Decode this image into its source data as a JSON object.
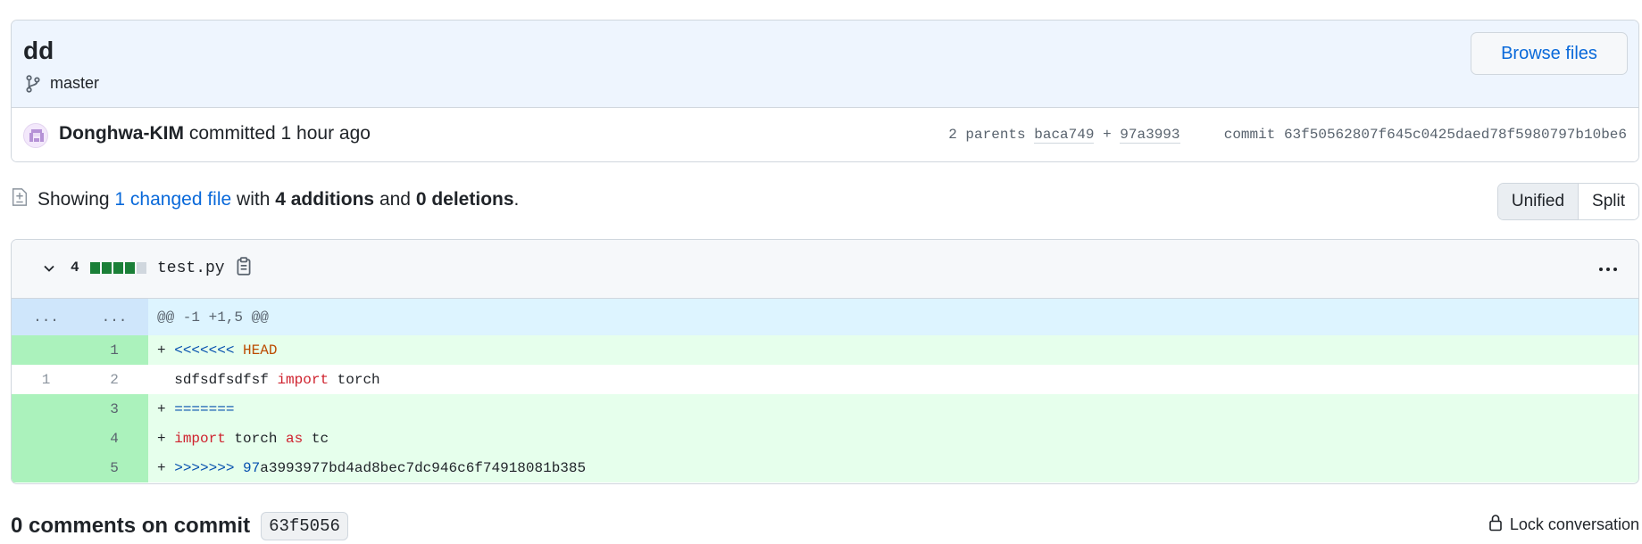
{
  "commit": {
    "title": "dd",
    "branch": "master",
    "browse_label": "Browse files",
    "author": "Donghwa-KIM",
    "action": "committed",
    "time": "1 hour ago",
    "parents_label": "2 parents",
    "parent1": "baca749",
    "parent_plus": "+",
    "parent2": "97a3993",
    "commit_label": "commit",
    "sha": "63f50562807f645c0425daed78f5980797b10be6"
  },
  "summary": {
    "showing": "Showing",
    "changed_files": "1 changed file",
    "with": "with",
    "additions": "4 additions",
    "and": "and",
    "deletions": "0 deletions",
    "period": "."
  },
  "view_toggle": {
    "unified": "Unified",
    "split": "Split",
    "active": "unified"
  },
  "file": {
    "changes": "4",
    "diffstat": {
      "added_blocks": 4,
      "empty_blocks": 1
    },
    "name": "test.py",
    "hunk": {
      "left": "...",
      "right": "...",
      "header": "@@ -1 +1,5 @@"
    },
    "lines": [
      {
        "type": "add",
        "left": "",
        "right": "1",
        "prefix": "+",
        "tokens": [
          [
            "<<<<<<<",
            "mk"
          ],
          [
            " ",
            ""
          ],
          [
            "HEAD",
            "or"
          ]
        ]
      },
      {
        "type": "ctx",
        "left": "1",
        "right": "2",
        "prefix": " ",
        "tokens": [
          [
            "sdfsdfsdfsf ",
            ""
          ],
          [
            "import",
            "kw"
          ],
          [
            " torch",
            ""
          ]
        ]
      },
      {
        "type": "add",
        "left": "",
        "right": "3",
        "prefix": "+",
        "tokens": [
          [
            "=======",
            "mk"
          ]
        ]
      },
      {
        "type": "add",
        "left": "",
        "right": "4",
        "prefix": "+",
        "tokens": [
          [
            "import",
            "kw"
          ],
          [
            " torch ",
            ""
          ],
          [
            "as",
            "kw"
          ],
          [
            " tc",
            ""
          ]
        ]
      },
      {
        "type": "add",
        "left": "",
        "right": "5",
        "prefix": "+",
        "tokens": [
          [
            ">>>>>>>",
            "mk"
          ],
          [
            " ",
            ""
          ],
          [
            "97",
            "bl"
          ],
          [
            "a3993977bd4ad8bec7dc946c6f74918081b385",
            ""
          ]
        ]
      }
    ]
  },
  "footer": {
    "comments_label": "0 comments on commit",
    "short_sha": "63f5056",
    "lock_label": "Lock conversation"
  },
  "colors": {
    "accent": "#0969da",
    "add_bg": "#e6ffec",
    "add_num_bg": "#abf2bc",
    "hunk_bg": "#ddf4ff",
    "diffstat_green": "#1a7f37"
  }
}
